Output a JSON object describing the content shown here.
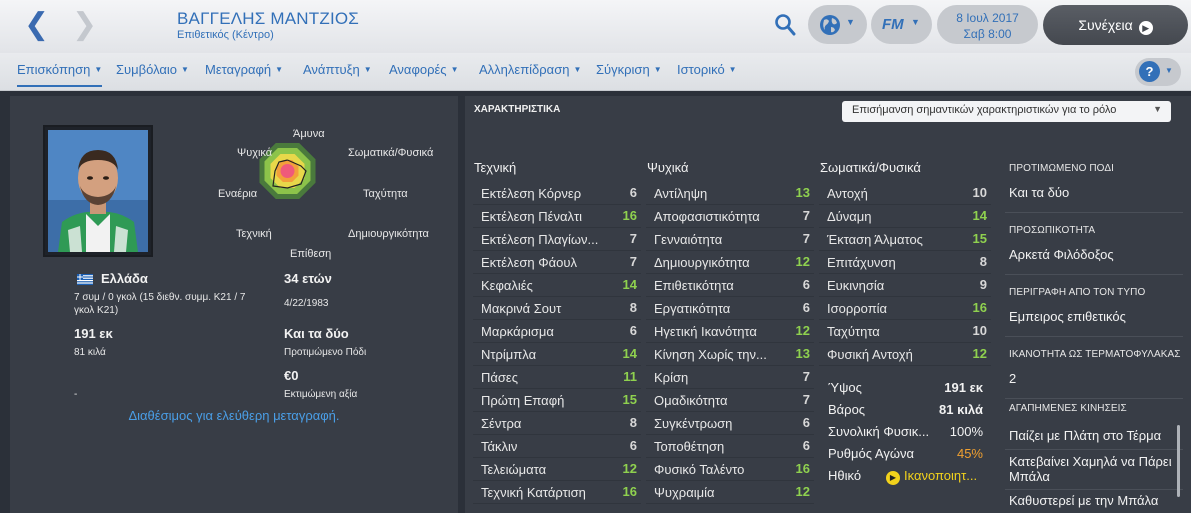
{
  "header": {
    "player_name": "ΒΑΓΓΕΛΗΣ ΜΑΝΤΖΙΟΣ",
    "position": "Επιθετικός (Κέντρο)",
    "date_line1": "8 Ιουλ 2017",
    "date_line2": "Σαβ 8:00",
    "continue_label": "Συνέχεια",
    "back_glyph": "❮",
    "forward_glyph": "❯",
    "fm_logo": "FM"
  },
  "tabs": [
    {
      "label": "Επισκόπηση",
      "active": true
    },
    {
      "label": "Συμβόλαιο"
    },
    {
      "label": "Μεταγραφή"
    },
    {
      "label": "Ανάπτυξη"
    },
    {
      "label": "Αναφορές"
    },
    {
      "label": "Αλληλεπίδραση"
    },
    {
      "label": "Σύγκριση"
    },
    {
      "label": "Ιστορικό"
    }
  ],
  "help_label": "?",
  "radar": {
    "labels": {
      "top": "Άμυνα",
      "top_right": "Σωματικά/Φυσικά",
      "right": "Ταχύτητα",
      "bottom_right": "Δημιουργικότητα",
      "bottom": "Επίθεση",
      "bottom_left": "Τεχνική",
      "left": "Εναέρια",
      "top_left": "Ψυχικά"
    }
  },
  "overview": {
    "nationality": "Ελλάδα",
    "caps_line1": "7 συμ / 0 γκολ (15 διεθν. συμμ. Κ21 / 7",
    "caps_line2": "γκολ Κ21)",
    "height": "191 εκ",
    "weight": "81 κιλά",
    "dash": "-",
    "age": "34 ετών",
    "dob": "4/22/1983",
    "preferred_foot": "Και τα δύο",
    "preferred_foot_label": "Προτιμώμενο Πόδι",
    "value": "€0",
    "value_label": "Εκτιμώμενη αξία",
    "free_transfer": "Διαθέσιμος για ελεύθερη μεταγραφή."
  },
  "attributes": {
    "title": "ΧΑΡΑΚΤΗΡΙΣΤΙΚΑ",
    "highlight_select": "Επισήμανση σημαντικών χαρακτηριστικών για το ρόλο",
    "technical_head": "Τεχνική",
    "mental_head": "Ψυχικά",
    "physical_head": "Σωματικά/Φυσικά",
    "technical": [
      {
        "name": "Εκτέλεση Κόρνερ",
        "value": "6"
      },
      {
        "name": "Εκτέλεση Πέναλτι",
        "value": "16"
      },
      {
        "name": "Εκτέλεση Πλαγίων...",
        "value": "7"
      },
      {
        "name": "Εκτέλεση Φάουλ",
        "value": "7"
      },
      {
        "name": "Κεφαλιές",
        "value": "14"
      },
      {
        "name": "Μακρινά Σουτ",
        "value": "8"
      },
      {
        "name": "Μαρκάρισμα",
        "value": "6"
      },
      {
        "name": "Ντρίμπλα",
        "value": "14"
      },
      {
        "name": "Πάσες",
        "value": "11"
      },
      {
        "name": "Πρώτη Επαφή",
        "value": "15"
      },
      {
        "name": "Σέντρα",
        "value": "8"
      },
      {
        "name": "Τάκλιν",
        "value": "6"
      },
      {
        "name": "Τελειώματα",
        "value": "12"
      },
      {
        "name": "Τεχνική Κατάρτιση",
        "value": "16"
      }
    ],
    "mental": [
      {
        "name": "Αντίληψη",
        "value": "13"
      },
      {
        "name": "Αποφασιστικότητα",
        "value": "7"
      },
      {
        "name": "Γενναιότητα",
        "value": "7"
      },
      {
        "name": "Δημιουργικότητα",
        "value": "12"
      },
      {
        "name": "Επιθετικότητα",
        "value": "6"
      },
      {
        "name": "Εργατικότητα",
        "value": "6"
      },
      {
        "name": "Ηγετική Ικανότητα",
        "value": "12"
      },
      {
        "name": "Κίνηση Χωρίς την...",
        "value": "13"
      },
      {
        "name": "Κρίση",
        "value": "7"
      },
      {
        "name": "Ομαδικότητα",
        "value": "7"
      },
      {
        "name": "Συγκέντρωση",
        "value": "6"
      },
      {
        "name": "Τοποθέτηση",
        "value": "6"
      },
      {
        "name": "Φυσικό Ταλέντο",
        "value": "16"
      },
      {
        "name": "Ψυχραιμία",
        "value": "12"
      }
    ],
    "physical": [
      {
        "name": "Αντοχή",
        "value": "10"
      },
      {
        "name": "Δύναμη",
        "value": "14"
      },
      {
        "name": "Έκταση Άλματος",
        "value": "15"
      },
      {
        "name": "Επιτάχυνση",
        "value": "8"
      },
      {
        "name": "Ευκινησία",
        "value": "9"
      },
      {
        "name": "Ισορροπία",
        "value": "16"
      },
      {
        "name": "Ταχύτητα",
        "value": "10"
      },
      {
        "name": "Φυσική Αντοχή",
        "value": "12"
      }
    ],
    "physical_info": [
      {
        "name": "Ύψος",
        "value": "191 εκ"
      },
      {
        "name": "Βάρος",
        "value": "81 κιλά"
      },
      {
        "name": "Συνολική Φυσικ...",
        "value": "100%"
      },
      {
        "name": "Ρυθμός Αγώνα",
        "value": "45%"
      },
      {
        "name": "Ηθικό",
        "value": "Ικανοποιητ..."
      }
    ]
  },
  "side_info": {
    "pref_foot_head": "ΠΡΟΤΙΜΩΜΕΝΟ ΠΟΔΙ",
    "pref_foot": "Και τα δύο",
    "personality_head": "ΠΡΟΣΩΠΙΚΟΤΗΤΑ",
    "personality": "Αρκετά Φιλόδοξος",
    "media_head": "ΠΕΡΙΓΡΑΦΗ ΑΠΟ ΤΟΝ ΤΥΠΟ",
    "media": "Εμπειρος επιθετικός",
    "gk_head": "ΙΚΑΝΟΤΗΤΑ ΩΣ ΤΕΡΜΑΤΟΦΥΛΑΚΑΣ",
    "gk": "2",
    "moves_head": "ΑΓΑΠΗΜΕΝΕΣ ΚΙΝΗΣΕΙΣ",
    "moves": [
      "Παίζει με Πλάτη στο Τέρμα",
      "Κατεβαίνει Χαμηλά να Πάρει",
      "Μπάλα",
      "Καθυστερεί με την Μπάλα"
    ]
  },
  "colors": {
    "accent": "#3270b8",
    "highlight_green": "#8fd14f",
    "match_fitness_orange": "#f0a030",
    "morale_yellow": "#f2d21c"
  },
  "icons": [
    "back-arrow-icon",
    "forward-arrow-icon",
    "search-icon",
    "globe-icon",
    "fm-icon",
    "play-icon",
    "help-icon",
    "chevron-down-icon",
    "greece-flag-icon",
    "morale-icon"
  ]
}
